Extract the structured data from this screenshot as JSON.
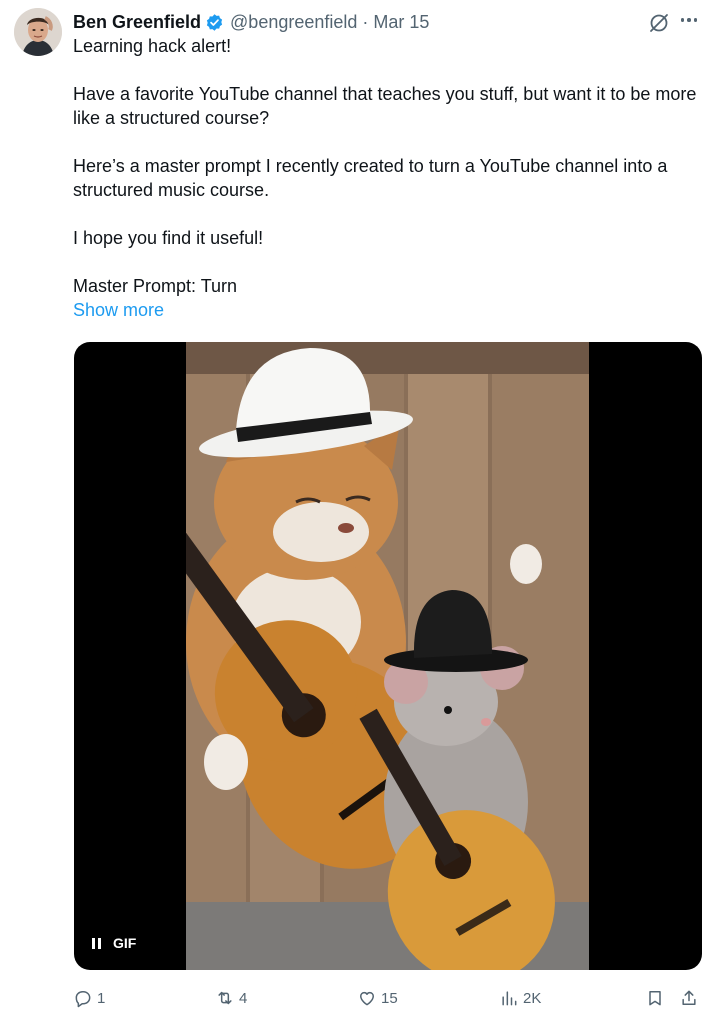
{
  "author": {
    "name": "Ben Greenfield",
    "handle": "@bengreenfield",
    "separator": "·",
    "date": "Mar 15",
    "verified": true
  },
  "post": {
    "paragraphs": [
      "Learning hack alert!",
      "Have a favorite YouTube channel that teaches you stuff, but want it to be more like a structured course?",
      "Here’s a master prompt I recently created to turn a YouTube channel into a structured music course.",
      "I hope you find it useful!",
      "Master Prompt: Turn"
    ],
    "show_more": "Show more"
  },
  "media": {
    "type": "gif",
    "badge_label": "GIF",
    "playing": true
  },
  "actions": {
    "replies": "1",
    "reposts": "4",
    "likes": "15",
    "views": "2K"
  },
  "colors": {
    "accent": "#1d9bf0",
    "text_primary": "#0f1419",
    "text_secondary": "#536471"
  },
  "icons": [
    "verified-badge-icon",
    "grok-icon",
    "more-icon",
    "pause-icon",
    "reply-icon",
    "repost-icon",
    "like-icon",
    "views-icon",
    "bookmark-icon",
    "share-icon"
  ]
}
